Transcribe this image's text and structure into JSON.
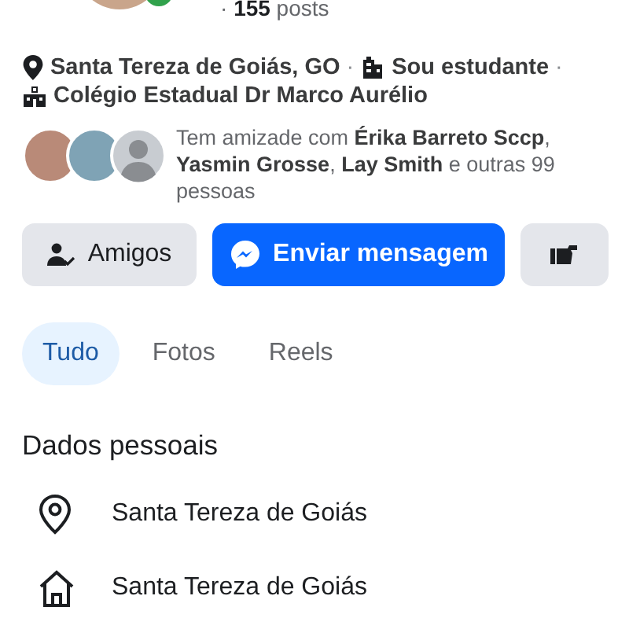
{
  "header": {
    "posts": "· **155** posts"
  },
  "intro": [
    {
      "kind": "location",
      "text": "Santa Tereza de Goiás, GO",
      "separator": "·"
    },
    {
      "kind": "work",
      "text": "Sou estudante",
      "separator": "·"
    },
    {
      "kind": "school",
      "text": "Colégio Estadual Dr Marco Aurélio"
    }
  ],
  "mutual_friends": {
    "avatars": [
      {
        "kind": "photo"
      },
      {
        "kind": "photo"
      },
      {
        "kind": "default"
      }
    ],
    "text": "Tem amizade com **Érika Barreto Sccp**, **Yasmin Grosse**, **Lay Smith** e outras 99 pessoas"
  },
  "actions": [
    {
      "kind": "friends",
      "label": "Amigos"
    },
    {
      "kind": "message",
      "label": "Enviar mensagem"
    },
    {
      "kind": "more"
    }
  ],
  "tabs": [
    {
      "label": "Tudo",
      "selected": true
    },
    {
      "label": "Fotos",
      "selected": false
    },
    {
      "label": "Reels",
      "selected": false
    }
  ],
  "details": {
    "title": "Dados pessoais",
    "items": [
      {
        "kind": "location",
        "text": "Santa Tereza de Goiás"
      },
      {
        "kind": "home",
        "text": "Santa Tereza de Goiás"
      }
    ]
  }
}
